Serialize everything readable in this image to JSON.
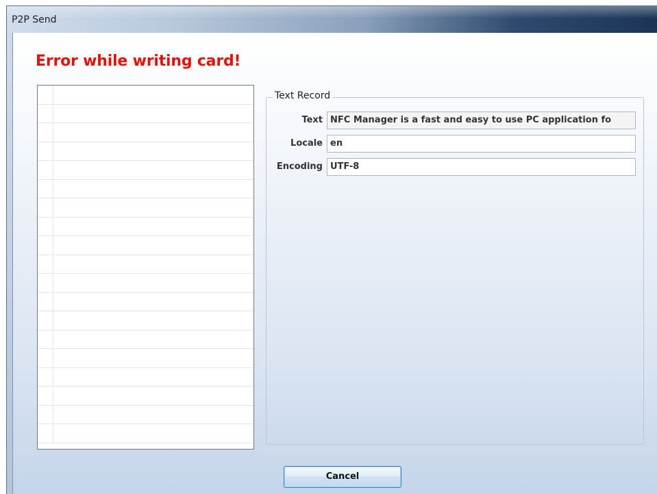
{
  "window": {
    "title": "P2P Send"
  },
  "message": {
    "error_title": "Error while writing card!",
    "color": "#e3120b"
  },
  "record_list": {
    "rows": 19
  },
  "text_record": {
    "group_label": "Text Record",
    "fields": [
      {
        "label": "Text",
        "value": "NFC Manager is a fast and easy to use PC application fo"
      },
      {
        "label": "Locale",
        "value": "en"
      },
      {
        "label": "Encoding",
        "value": "UTF-8"
      }
    ]
  },
  "buttons": {
    "cancel_label": "Cancel"
  }
}
